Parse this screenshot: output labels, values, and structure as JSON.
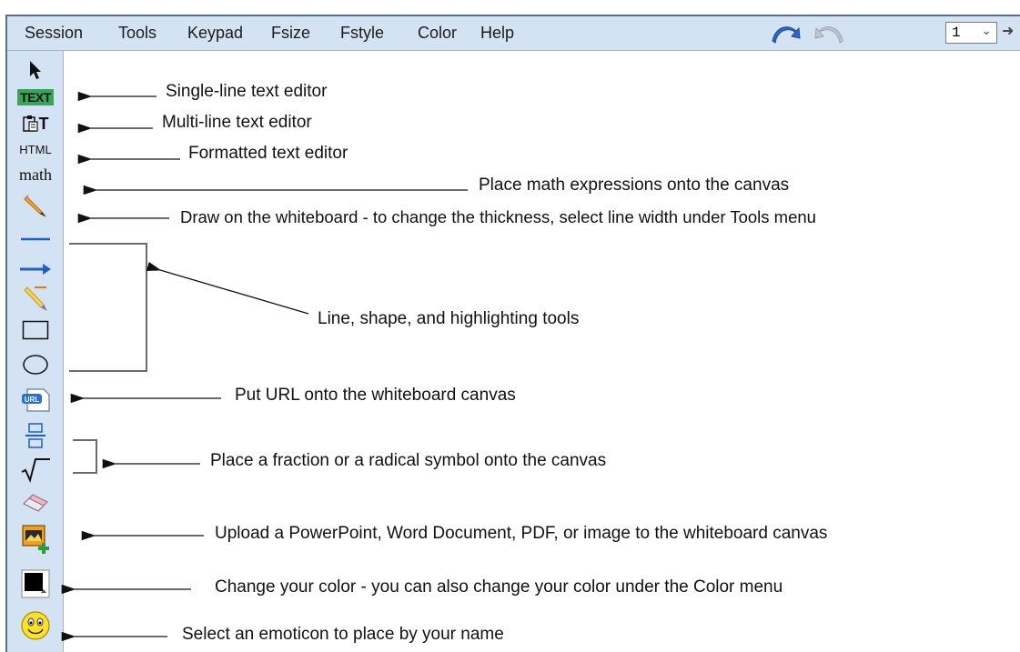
{
  "menubar": {
    "items": [
      "Session",
      "Tools",
      "Keypad",
      "Fsize",
      "Fstyle",
      "Color",
      "Help"
    ],
    "page_value": "1"
  },
  "toolbar": {
    "text_tool_label": "TEXT",
    "multiline_tool_label": "T",
    "html_tool_label": "HTML",
    "math_tool_label": "math",
    "url_tool_label": "URL"
  },
  "annotations": {
    "single_line": "Single-line text editor",
    "multi_line": "Multi-line text editor",
    "formatted": "Formatted text editor",
    "math": "Place math expressions onto the canvas",
    "draw": "Draw on the whiteboard - to change the thickness, select line width under Tools menu",
    "line_shape": "Line, shape, and highlighting tools",
    "url": "Put URL onto the whiteboard canvas",
    "fraction": "Place a fraction or a radical symbol onto the canvas",
    "upload": "Upload a PowerPoint, Word Document, PDF, or image to the whiteboard canvas",
    "color": "Change your color - you can also change your color under the Color menu",
    "emoticon": "Select an emoticon to place by your name"
  },
  "colors": {
    "bar_bg": "#d4e3f4",
    "icon_blue": "#1f5fbf",
    "text_green": "#3aa45a"
  }
}
